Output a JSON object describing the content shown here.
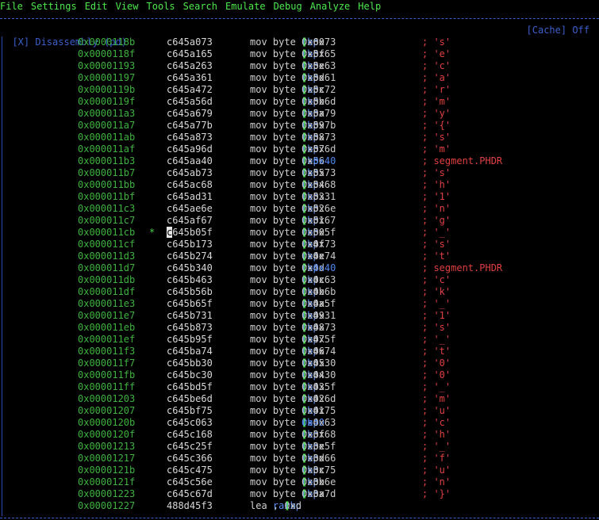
{
  "menu": [
    "File",
    "Settings",
    "Edit",
    "View",
    "Tools",
    "Search",
    "Emulate",
    "Debug",
    "Analyze",
    "Help"
  ],
  "panel": {
    "title": "[X] Disassembly (pd)",
    "cache_status": "[Cache] Off"
  },
  "rows": [
    {
      "addr": "0x0000118b",
      "bytes": "c645a073",
      "offset": "0x60",
      "imm": "0x73",
      "comment": "; 's'"
    },
    {
      "addr": "0x0000118f",
      "bytes": "c645a165",
      "offset": "0x5f",
      "imm": "0x65",
      "comment": "; 'e'"
    },
    {
      "addr": "0x00001193",
      "bytes": "c645a263",
      "offset": "0x5e",
      "imm": "0x63",
      "comment": "; 'c'"
    },
    {
      "addr": "0x00001197",
      "bytes": "c645a361",
      "offset": "0x5d",
      "imm": "0x61",
      "comment": "; 'a'"
    },
    {
      "addr": "0x0000119b",
      "bytes": "c645a472",
      "offset": "0x5c",
      "imm": "0x72",
      "comment": "; 'r'"
    },
    {
      "addr": "0x0000119f",
      "bytes": "c645a56d",
      "offset": "0x5b",
      "imm": "0x6d",
      "comment": "; 'm'"
    },
    {
      "addr": "0x000011a3",
      "bytes": "c645a679",
      "offset": "0x5a",
      "imm": "0x79",
      "comment": "; 'y'"
    },
    {
      "addr": "0x000011a7",
      "bytes": "c645a77b",
      "offset": "0x59",
      "imm": "0x7b",
      "comment": "; '{'"
    },
    {
      "addr": "0x000011ab",
      "bytes": "c645a873",
      "offset": "0x58",
      "imm": "0x73",
      "comment": "; 's'"
    },
    {
      "addr": "0x000011af",
      "bytes": "c645a96d",
      "offset": "0x57",
      "imm": "0x6d",
      "comment": "; 'm'"
    },
    {
      "addr": "0x000011b3",
      "bytes": "c645aa40",
      "offset": "0x56",
      "imm": "0x40",
      "comment": "; segment.PHDR",
      "imm_blue": true
    },
    {
      "addr": "0x000011b7",
      "bytes": "c645ab73",
      "offset": "0x55",
      "imm": "0x73",
      "comment": "; 's'"
    },
    {
      "addr": "0x000011bb",
      "bytes": "c645ac68",
      "offset": "0x54",
      "imm": "0x68",
      "comment": "; 'h'"
    },
    {
      "addr": "0x000011bf",
      "bytes": "c645ad31",
      "offset": "0x53",
      "imm": "0x31",
      "comment": "; '1'"
    },
    {
      "addr": "0x000011c3",
      "bytes": "c645ae6e",
      "offset": "0x52",
      "imm": "0x6e",
      "comment": "; 'n'"
    },
    {
      "addr": "0x000011c7",
      "bytes": "c645af67",
      "offset": "0x51",
      "imm": "0x67",
      "comment": "; 'g'"
    },
    {
      "addr": "0x000011cb",
      "bytes": "c645b05f",
      "offset": "0x50",
      "imm": "0x5f",
      "comment": "; '_'",
      "marker": "*",
      "cursor": true
    },
    {
      "addr": "0x000011cf",
      "bytes": "c645b173",
      "offset": "0x4f",
      "imm": "0x73",
      "comment": "; 's'"
    },
    {
      "addr": "0x000011d3",
      "bytes": "c645b274",
      "offset": "0x4e",
      "imm": "0x74",
      "comment": "; 't'"
    },
    {
      "addr": "0x000011d7",
      "bytes": "c645b340",
      "offset": "0x4d",
      "imm": "0x40",
      "comment": "; segment.PHDR",
      "imm_blue": true
    },
    {
      "addr": "0x000011db",
      "bytes": "c645b463",
      "offset": "0x4c",
      "imm": "0x63",
      "comment": "; 'c'"
    },
    {
      "addr": "0x000011df",
      "bytes": "c645b56b",
      "offset": "0x4b",
      "imm": "0x6b",
      "comment": "; 'k'"
    },
    {
      "addr": "0x000011e3",
      "bytes": "c645b65f",
      "offset": "0x4a",
      "imm": "0x5f",
      "comment": "; '_'"
    },
    {
      "addr": "0x000011e7",
      "bytes": "c645b731",
      "offset": "0x49",
      "imm": "0x31",
      "comment": "; '1'"
    },
    {
      "addr": "0x000011eb",
      "bytes": "c645b873",
      "offset": "0x48",
      "imm": "0x73",
      "comment": "; 's'"
    },
    {
      "addr": "0x000011ef",
      "bytes": "c645b95f",
      "offset": "0x47",
      "imm": "0x5f",
      "comment": "; '_'"
    },
    {
      "addr": "0x000011f3",
      "bytes": "c645ba74",
      "offset": "0x46",
      "imm": "0x74",
      "comment": "; 't'"
    },
    {
      "addr": "0x000011f7",
      "bytes": "c645bb30",
      "offset": "0x45",
      "imm": "0x30",
      "comment": "; '0'"
    },
    {
      "addr": "0x000011fb",
      "bytes": "c645bc30",
      "offset": "0x44",
      "imm": "0x30",
      "comment": "; '0'"
    },
    {
      "addr": "0x000011ff",
      "bytes": "c645bd5f",
      "offset": "0x43",
      "imm": "0x5f",
      "comment": "; '_'"
    },
    {
      "addr": "0x00001203",
      "bytes": "c645be6d",
      "offset": "0x42",
      "imm": "0x6d",
      "comment": "; 'm'"
    },
    {
      "addr": "0x00001207",
      "bytes": "c645bf75",
      "offset": "0x41",
      "imm": "0x75",
      "comment": "; 'u'"
    },
    {
      "addr": "0x0000120b",
      "bytes": "c645c063",
      "offset": "0x40",
      "imm": "0x63",
      "comment": "; 'c'",
      "offset_blue": true
    },
    {
      "addr": "0x0000120f",
      "bytes": "c645c168",
      "offset": "0x3f",
      "imm": "0x68",
      "comment": "; 'h'"
    },
    {
      "addr": "0x00001213",
      "bytes": "c645c25f",
      "offset": "0x3e",
      "imm": "0x5f",
      "comment": "; '_'"
    },
    {
      "addr": "0x00001217",
      "bytes": "c645c366",
      "offset": "0x3d",
      "imm": "0x66",
      "comment": "; 'f'"
    },
    {
      "addr": "0x0000121b",
      "bytes": "c645c475",
      "offset": "0x3c",
      "imm": "0x75",
      "comment": "; 'u'"
    },
    {
      "addr": "0x0000121f",
      "bytes": "c645c56e",
      "offset": "0x3b",
      "imm": "0x6e",
      "comment": "; 'n'"
    },
    {
      "addr": "0x00001223",
      "bytes": "c645c67d",
      "offset": "0x3a",
      "imm": "0x7d",
      "comment": "; '}'"
    },
    {
      "addr": "0x00001227",
      "bytes": "488d45f3",
      "lea": true,
      "reg": "rax",
      "offset": "0xd",
      "comment": ""
    }
  ],
  "text": {
    "mov": "mov byte ",
    "lea": "lea ",
    "rbp": "rbp",
    "minus": " - "
  }
}
